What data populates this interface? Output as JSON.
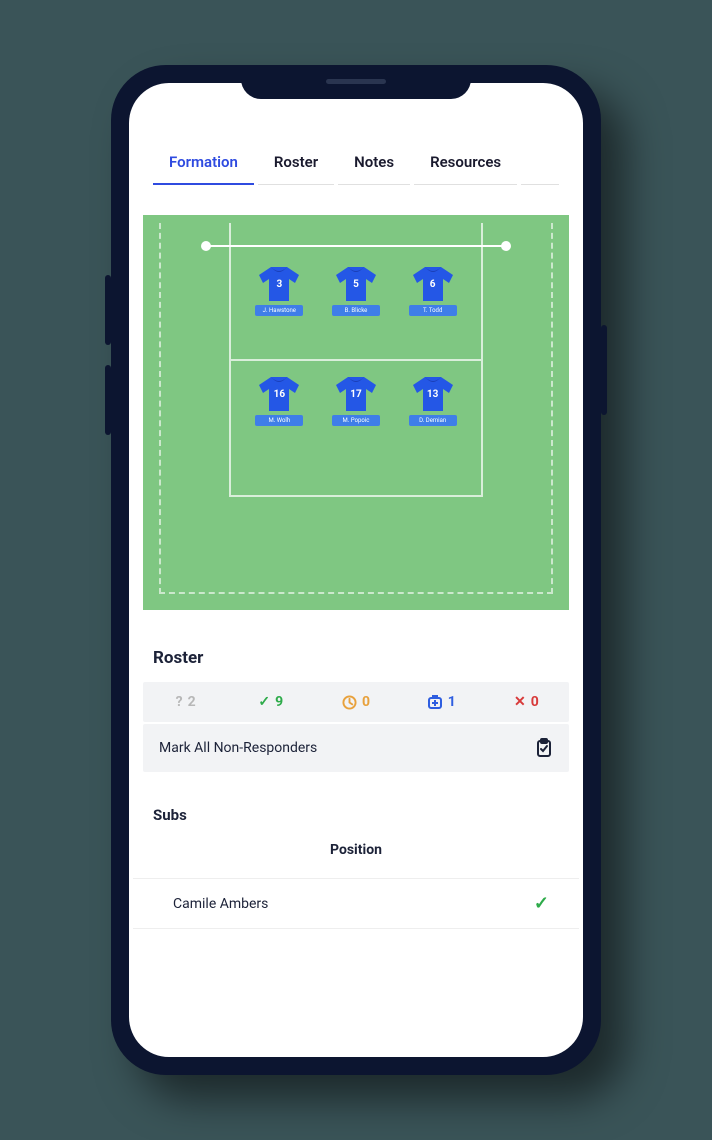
{
  "tabs": [
    {
      "label": "Formation",
      "active": true
    },
    {
      "label": "Roster",
      "active": false
    },
    {
      "label": "Notes",
      "active": false
    },
    {
      "label": "Resources",
      "active": false
    }
  ],
  "formation": {
    "row1": [
      {
        "num": "3",
        "name": "J. Hawstone"
      },
      {
        "num": "5",
        "name": "B. Blicke"
      },
      {
        "num": "6",
        "name": "T. Todd"
      }
    ],
    "row2": [
      {
        "num": "16",
        "name": "M. Wolh"
      },
      {
        "num": "17",
        "name": "M. Popoic"
      },
      {
        "num": "13",
        "name": "D. Demian"
      }
    ]
  },
  "roster": {
    "title": "Roster",
    "stats": {
      "unknown": "2",
      "yes": "9",
      "pending": "0",
      "injured": "1",
      "no": "0"
    },
    "mark_all_label": "Mark All Non-Responders"
  },
  "subs": {
    "title": "Subs",
    "position_header": "Position",
    "items": [
      {
        "name": "Camile Ambers",
        "status": "check"
      }
    ]
  }
}
